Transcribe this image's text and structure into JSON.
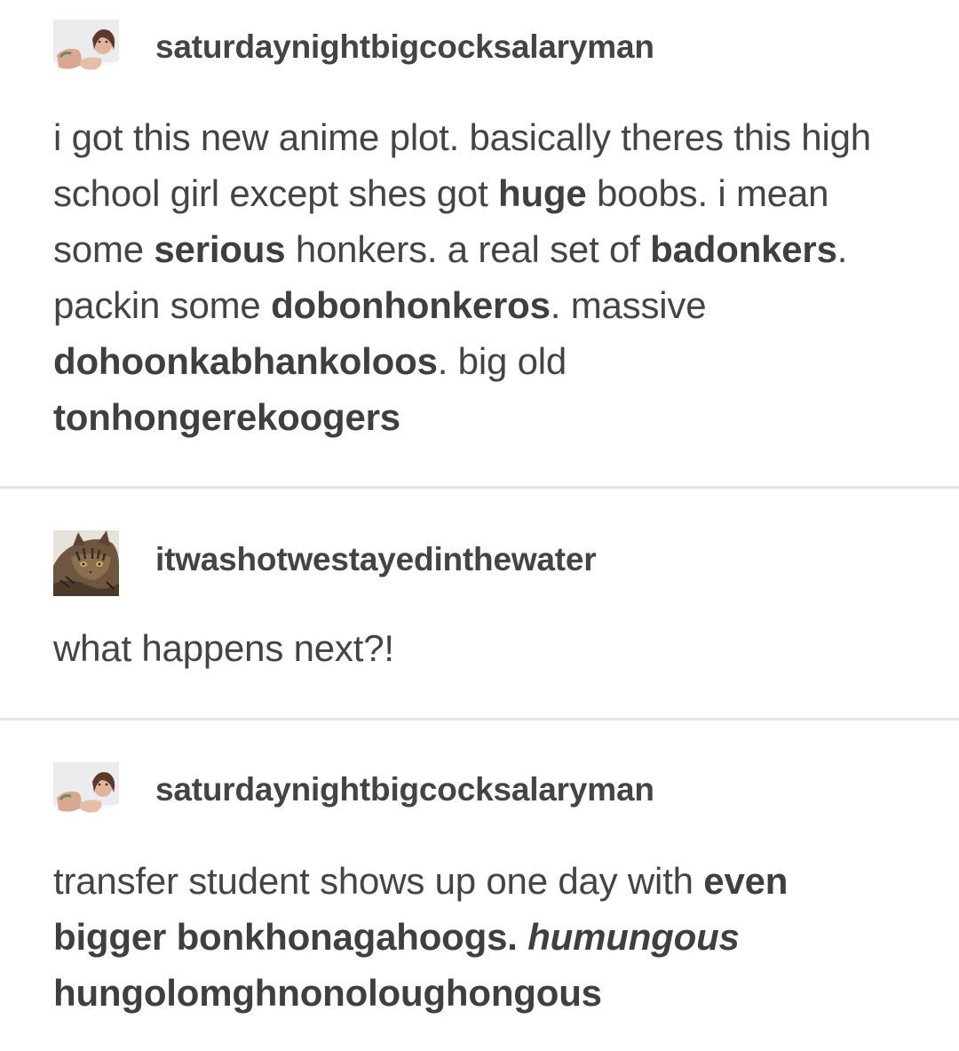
{
  "posts": [
    {
      "username": "saturdaynightbigcocksalaryman",
      "avatar_icon": "woman-lying-in-bed-avatar-icon",
      "body": {
        "s1": "i got this new anime plot. basically theres this high school girl except shes got ",
        "b1": "huge",
        "s2": " boobs. i mean some ",
        "b2": "serious",
        "s3": " honkers. a real set of ",
        "b3": "badonkers",
        "s4": ". packin some ",
        "b4": "dobonhonkeros",
        "s5": ". massive ",
        "b5": "dohoonkabhankoloos",
        "s6": ". big old ",
        "b6": "tonhongerekoogers"
      }
    },
    {
      "username": "itwashotwestayedinthewater",
      "avatar_icon": "tabby-cat-avatar-icon",
      "body": {
        "s1": "what happens next?!"
      }
    },
    {
      "username": "saturdaynightbigcocksalaryman",
      "avatar_icon": "woman-lying-in-bed-avatar-icon",
      "body": {
        "s1": "transfer student shows up one day with ",
        "b1": "even bigger bonkhonagahoogs.",
        "s2": " ",
        "bi1": "humungous",
        "s3": " ",
        "b2": "hungolomghnonoloughongous"
      }
    }
  ],
  "colors": {
    "text": "#444444",
    "divider": "#e4e4e4",
    "background": "#ffffff"
  }
}
